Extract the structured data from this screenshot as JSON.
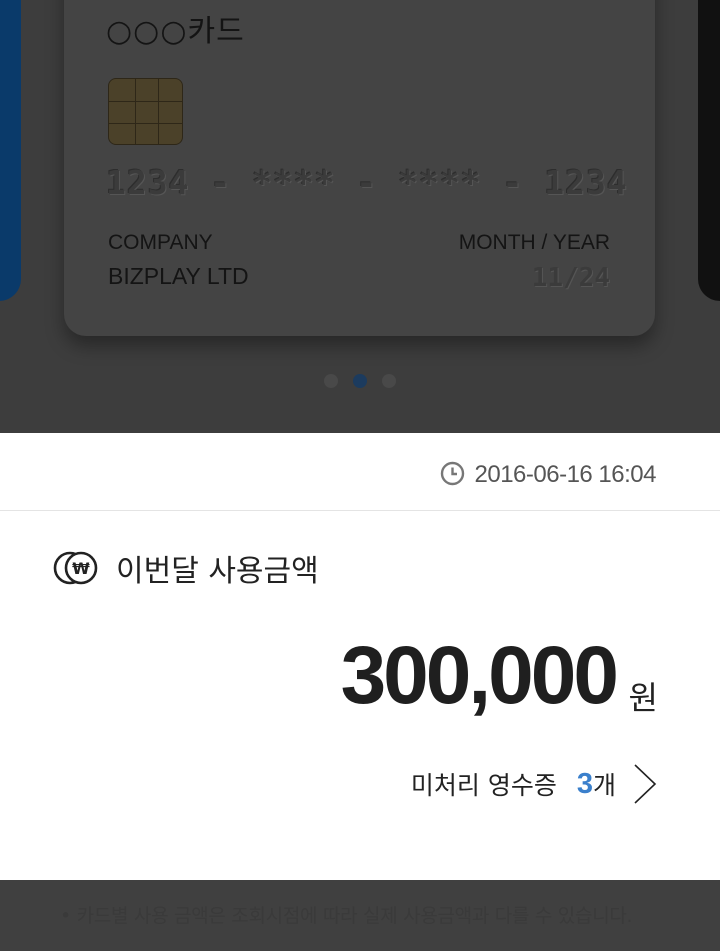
{
  "card": {
    "name": "○○○카드",
    "number": "1234 - **** - **** - 1234",
    "company_label": "COMPANY",
    "company_name": "BIZPLAY LTD",
    "expiry_label": "MONTH / YEAR",
    "expiry_value": "11/24"
  },
  "carousel": {
    "page_count": 3,
    "active_index": 1,
    "colors": {
      "dot_active": "#1c3b5e",
      "dot_inactive": "#494949",
      "left_card": "#0a3a6a",
      "right_card": "#111111"
    }
  },
  "timestamp": "2016-06-16 16:04",
  "usage": {
    "title": "이번달 사용금액",
    "amount": "300,000",
    "currency": "원"
  },
  "receipts": {
    "label": "미처리 영수증",
    "count": "3",
    "unit": "개",
    "count_color": "#3b80cc"
  },
  "notice": "• 카드별 사용 금액은 조회시점에 따라 실제 사용금액과 다를 수 있습니다."
}
